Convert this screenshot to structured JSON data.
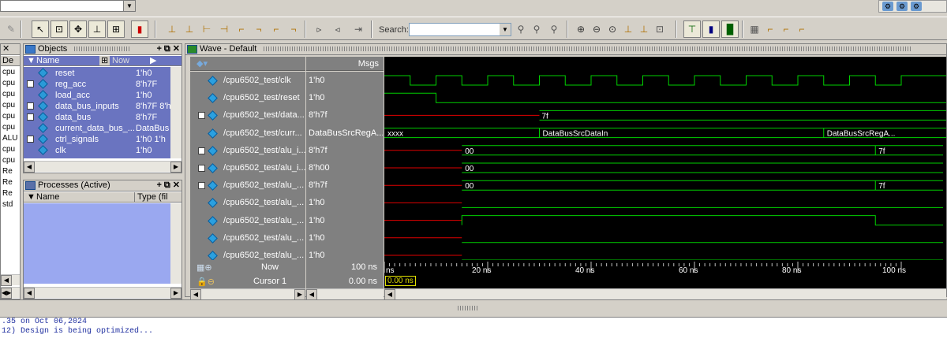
{
  "toolbar": {
    "search_label": "Search:",
    "search_value": ""
  },
  "objects_pane": {
    "title": "Objects",
    "col_name": "Name",
    "col_now": "Now",
    "items": [
      {
        "name": "reset",
        "value": "1'h0",
        "expandable": false
      },
      {
        "name": "reg_acc",
        "value": "8'h7F",
        "expandable": true
      },
      {
        "name": "load_acc",
        "value": "1'h0",
        "expandable": false
      },
      {
        "name": "data_bus_inputs",
        "value": "8'h7F 8'h",
        "expandable": true
      },
      {
        "name": "data_bus",
        "value": "8'h7F",
        "expandable": true
      },
      {
        "name": "current_data_bus_...",
        "value": "DataBus",
        "expandable": false
      },
      {
        "name": "ctrl_signals",
        "value": "1'h0 1'h",
        "expandable": true
      },
      {
        "name": "clk",
        "value": "1'h0",
        "expandable": false
      }
    ]
  },
  "left_strip": {
    "header": "De",
    "items": [
      "cpu",
      "cpu",
      "cpu",
      "cpu",
      "cpu",
      "cpu",
      "ALU",
      "cpu",
      "cpu",
      "Re",
      "Re",
      "Re",
      "std"
    ]
  },
  "processes_pane": {
    "title": "Processes (Active)",
    "col_name": "Name",
    "col_type": "Type (fil"
  },
  "wave_pane": {
    "title": "Wave - Default",
    "msgs_label": "Msgs",
    "signals": [
      {
        "name": "/cpu6502_test/clk",
        "value": "1'h0",
        "expandable": false
      },
      {
        "name": "/cpu6502_test/reset",
        "value": "1'h0",
        "expandable": false
      },
      {
        "name": "/cpu6502_test/data...",
        "value": "8'h7f",
        "expandable": true
      },
      {
        "name": "/cpu6502_test/curr...",
        "value": "DataBusSrcRegA...",
        "expandable": false
      },
      {
        "name": "/cpu6502_test/alu_i...",
        "value": "8'h7f",
        "expandable": true
      },
      {
        "name": "/cpu6502_test/alu_i...",
        "value": "8'h00",
        "expandable": true
      },
      {
        "name": "/cpu6502_test/alu_...",
        "value": "8'h7f",
        "expandable": true
      },
      {
        "name": "/cpu6502_test/alu_...",
        "value": "1'h0",
        "expandable": false
      },
      {
        "name": "/cpu6502_test/alu_...",
        "value": "1'h0",
        "expandable": false
      },
      {
        "name": "/cpu6502_test/alu_...",
        "value": "1'h0",
        "expandable": false
      },
      {
        "name": "/cpu6502_test/alu_...",
        "value": "1'h0",
        "expandable": false
      }
    ],
    "bus_labels": {
      "data_bus": "7f",
      "curr_initial": "xxxx",
      "curr_mid": "DataBusSrcDataIn",
      "curr_late": "DataBusSrcRegA...",
      "alu_in_a_initial": "00",
      "alu_in_a_late": "7f",
      "alu_in_b": "00",
      "alu_out_initial": "00",
      "alu_out_late": "7f"
    },
    "now_label": "Now",
    "now_value": "100 ns",
    "cursor_label": "Cursor 1",
    "cursor_value": "0.00 ns",
    "cursor_marker": "0.00 ns",
    "time_ticks": [
      "ns",
      "20 ns",
      "40 ns",
      "60 ns",
      "80 ns",
      "100 ns"
    ]
  },
  "transcript": {
    "lines": [
      ".35 on Oct 06,2024",
      "12) Design is being optimized..."
    ]
  },
  "colors": {
    "wave_green": "#00d000",
    "wave_red": "#e00000",
    "canvas_bg": "#000000",
    "cursor_yellow": "#e0e000"
  }
}
